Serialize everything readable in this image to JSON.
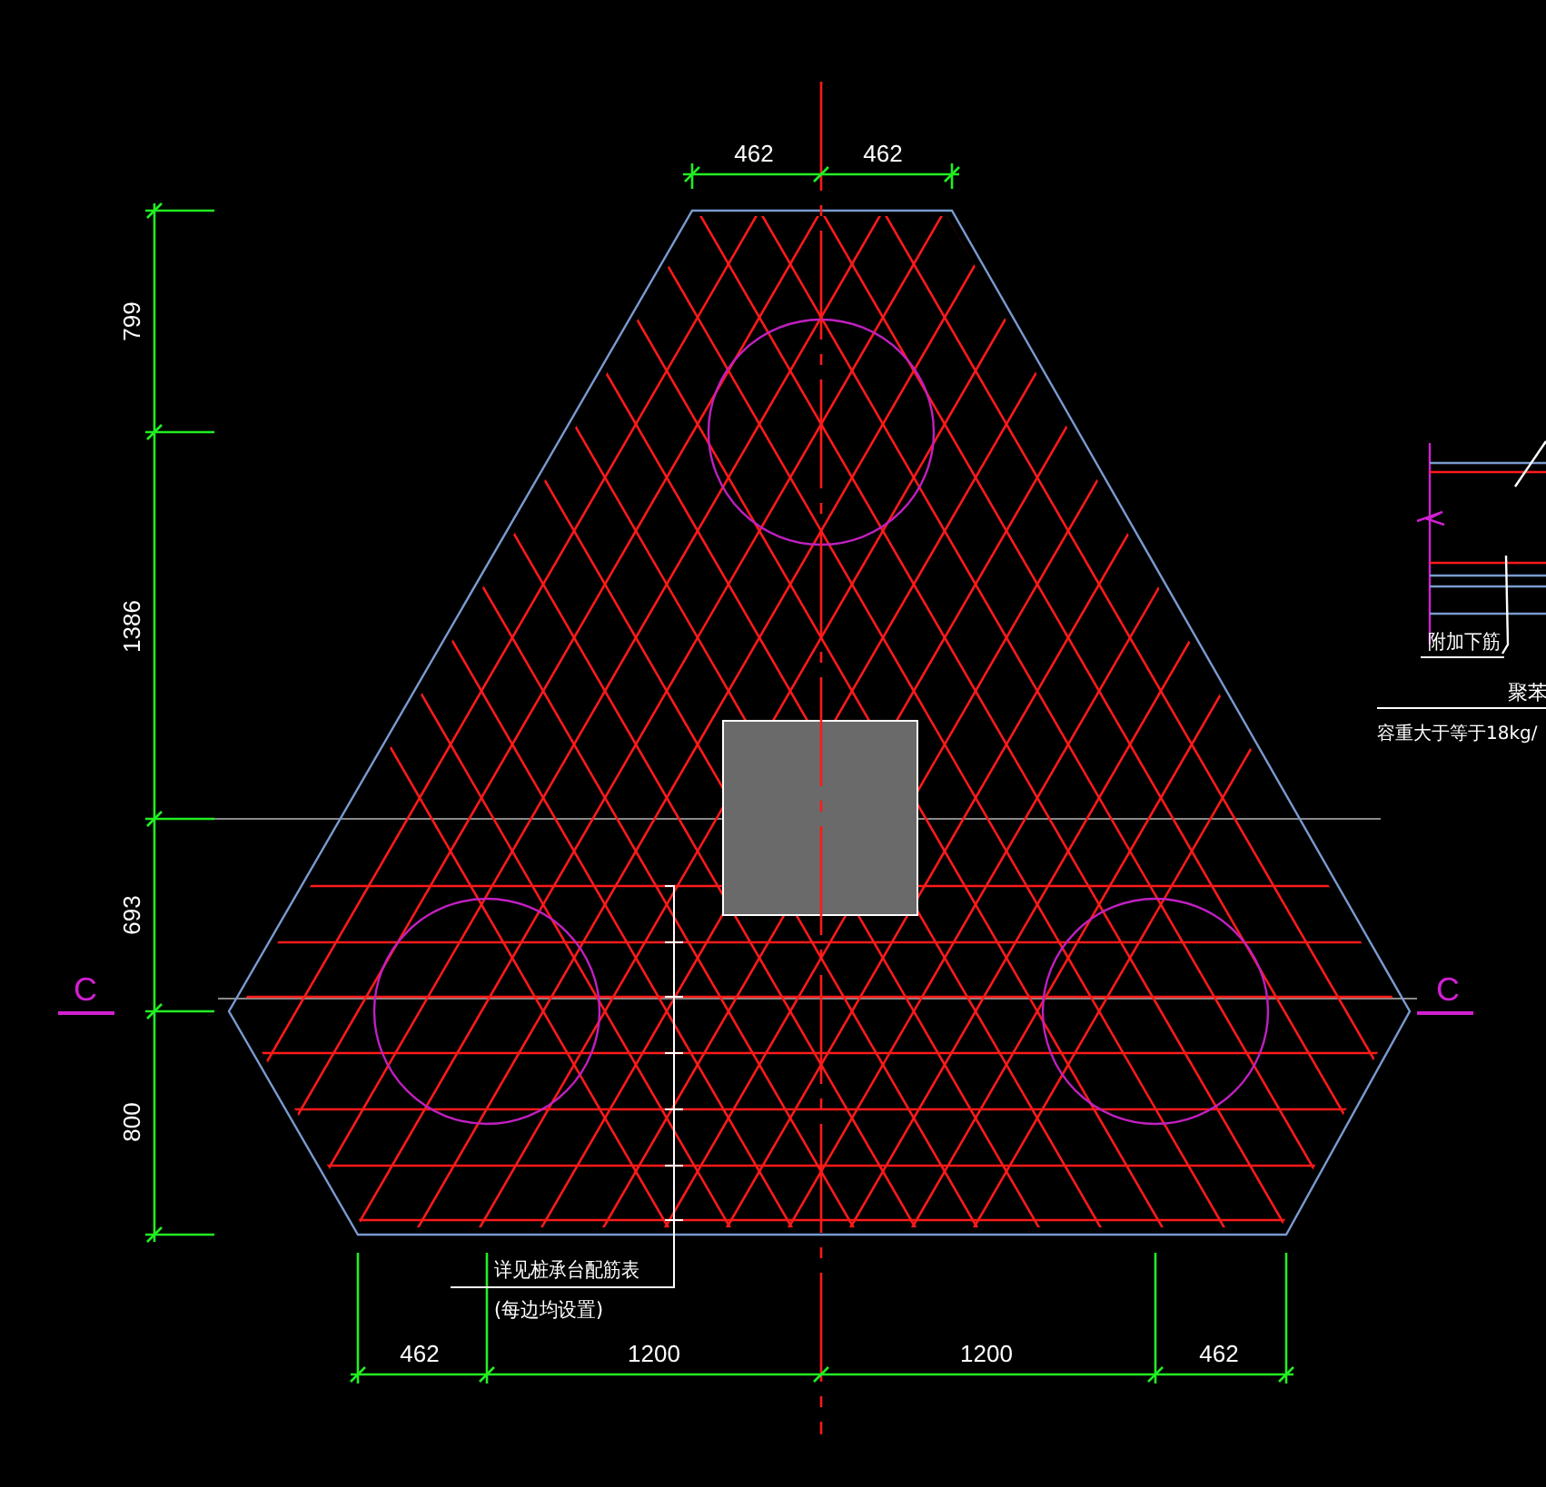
{
  "top_dimensions": [
    "462",
    "462"
  ],
  "left_dimensions": [
    "799",
    "1386",
    "693",
    "800"
  ],
  "bottom_dimensions": [
    "462",
    "1200",
    "1200",
    "462"
  ],
  "section_marks": [
    "C",
    "C"
  ],
  "note": {
    "line_1": "详见桩承台配筋表",
    "line_2": "(每边均设置)"
  },
  "detail": {
    "labels": [
      "附加下筋",
      "聚苯",
      "容重大于等于18kg/"
    ]
  }
}
